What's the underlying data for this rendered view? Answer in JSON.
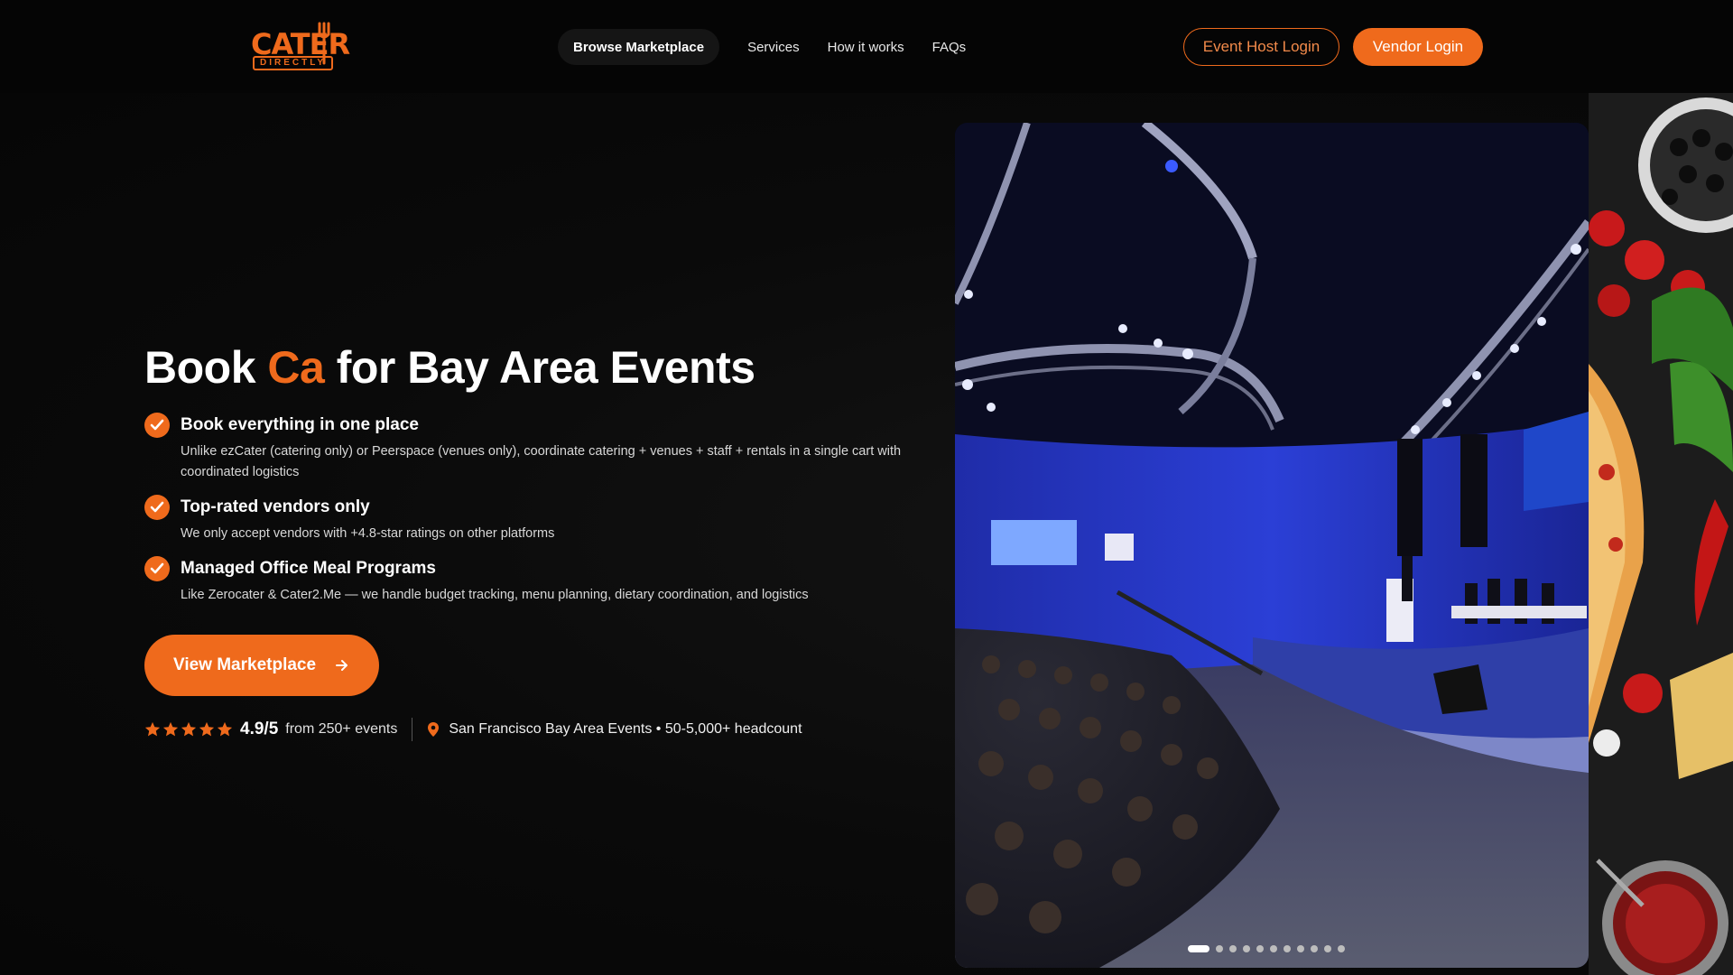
{
  "brand": {
    "name": "CATER",
    "sub": "DIRECTLY"
  },
  "nav": {
    "browse": "Browse Marketplace",
    "links": [
      "Services",
      "How it works",
      "FAQs"
    ],
    "host_login": "Event Host Login",
    "vendor_login": "Vendor Login"
  },
  "hero": {
    "headline_pre": "Book ",
    "headline_accent": "Ca",
    "headline_post": " for Bay Area Events",
    "features": [
      {
        "title": "Book everything in one place",
        "desc": "Unlike ezCater (catering only) or Peerspace (venues only), coordinate catering + venues + staff + rentals in a single cart with coordinated logistics"
      },
      {
        "title": "Top-rated vendors only",
        "desc": "We only accept vendors with +4.8-star ratings on other platforms"
      },
      {
        "title": "Managed Office Meal Programs",
        "desc": "Like Zerocater & Cater2.Me — we handle budget tracking, menu planning, dietary coordination, and logistics"
      }
    ],
    "cta": "View Marketplace",
    "rating_value": "4.9/5",
    "rating_label": "from 250+ events",
    "stars": 5,
    "location": "San Francisco Bay Area Events • 50-5,000+ headcount"
  },
  "carousel": {
    "slides": 11,
    "active": 0
  },
  "colors": {
    "accent": "#ef6a1c",
    "background": "#070707"
  }
}
